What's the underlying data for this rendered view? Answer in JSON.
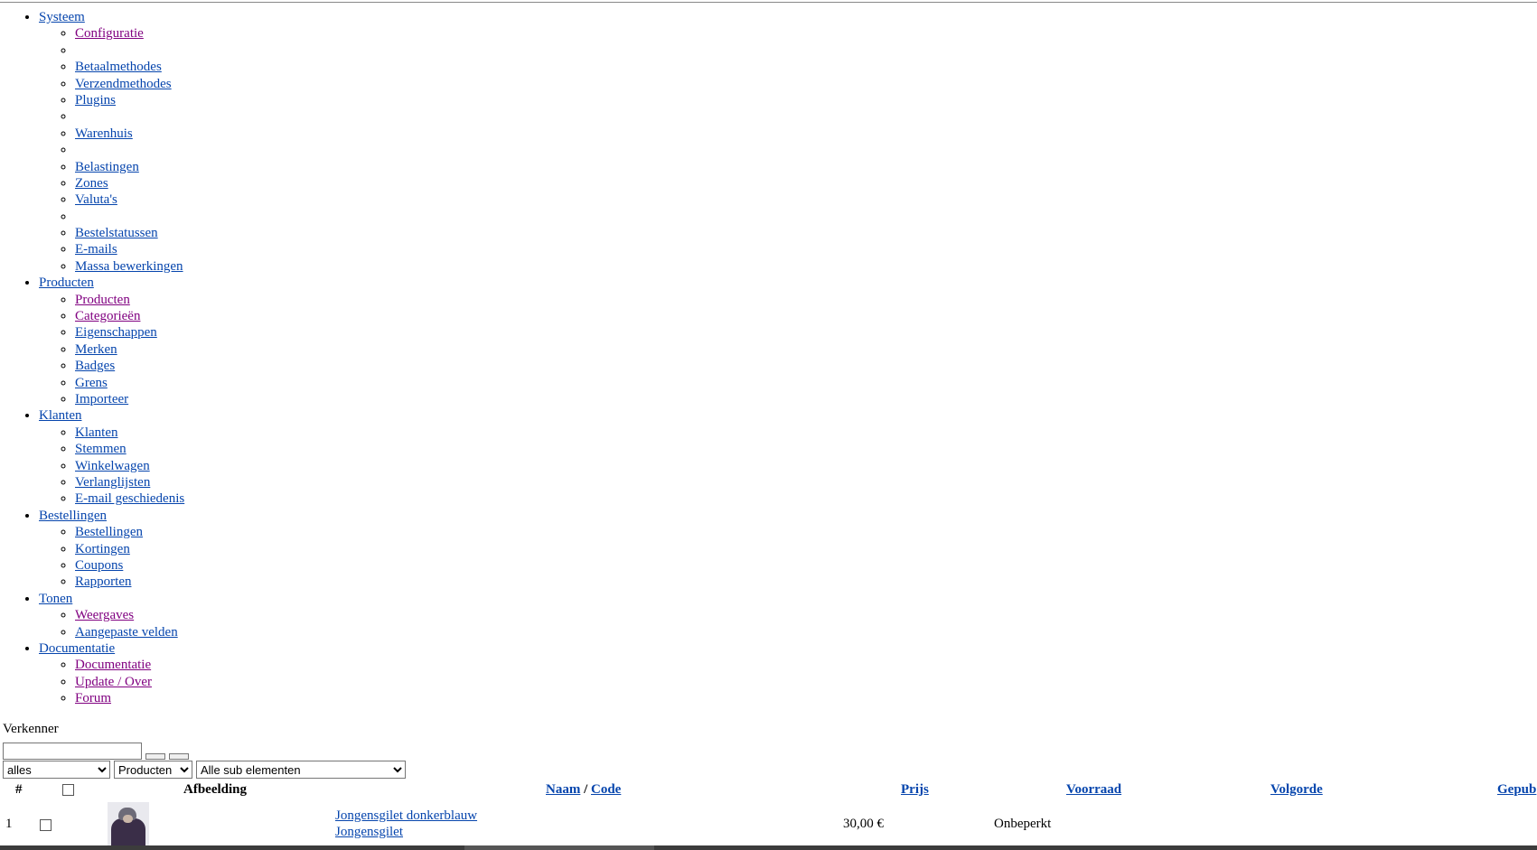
{
  "menu": [
    {
      "label": "Systeem",
      "items": [
        {
          "label": "Configuratie",
          "visited": true
        },
        {
          "label": ""
        },
        {
          "label": "Betaalmethodes"
        },
        {
          "label": "Verzendmethodes"
        },
        {
          "label": "Plugins"
        },
        {
          "label": ""
        },
        {
          "label": "Warenhuis"
        },
        {
          "label": ""
        },
        {
          "label": "Belastingen"
        },
        {
          "label": "Zones"
        },
        {
          "label": "Valuta's"
        },
        {
          "label": ""
        },
        {
          "label": "Bestelstatussen"
        },
        {
          "label": "E-mails"
        },
        {
          "label": "Massa bewerkingen"
        }
      ]
    },
    {
      "label": "Producten",
      "items": [
        {
          "label": "Producten",
          "visited": true
        },
        {
          "label": "Categorieën",
          "visited": true
        },
        {
          "label": "Eigenschappen"
        },
        {
          "label": "Merken"
        },
        {
          "label": "Badges"
        },
        {
          "label": "Grens"
        },
        {
          "label": "Importeer"
        }
      ]
    },
    {
      "label": "Klanten",
      "items": [
        {
          "label": "Klanten"
        },
        {
          "label": "Stemmen"
        },
        {
          "label": "Winkelwagen"
        },
        {
          "label": "Verlanglijsten"
        },
        {
          "label": "E-mail geschiedenis"
        }
      ]
    },
    {
      "label": "Bestellingen",
      "items": [
        {
          "label": "Bestellingen"
        },
        {
          "label": "Kortingen"
        },
        {
          "label": "Coupons"
        },
        {
          "label": "Rapporten"
        }
      ]
    },
    {
      "label": "Tonen",
      "items": [
        {
          "label": "Weergaves",
          "visited": true
        },
        {
          "label": "Aangepaste velden"
        }
      ]
    },
    {
      "label": "Documentatie",
      "items": [
        {
          "label": "Documentatie",
          "visited": true
        },
        {
          "label": "Update / Over",
          "visited": true
        },
        {
          "label": "Forum",
          "visited": true
        }
      ]
    }
  ],
  "explorer": {
    "label": "Verkenner",
    "search_value": ""
  },
  "filters": {
    "status": "alles",
    "type": "Producten",
    "sub": "Alle sub elementen"
  },
  "table": {
    "headers": {
      "num": "#",
      "image": "Afbeelding",
      "name": "Naam",
      "sep": "/",
      "code": "Code",
      "price": "Prijs",
      "stock": "Voorraad",
      "order": "Volgorde",
      "published": "Gepub"
    },
    "rows": [
      {
        "num": "1",
        "name": "Jongensgilet donkerblauw",
        "code": "Jongensgilet",
        "price": "30,00 €",
        "stock": "Onbeperkt"
      }
    ]
  }
}
